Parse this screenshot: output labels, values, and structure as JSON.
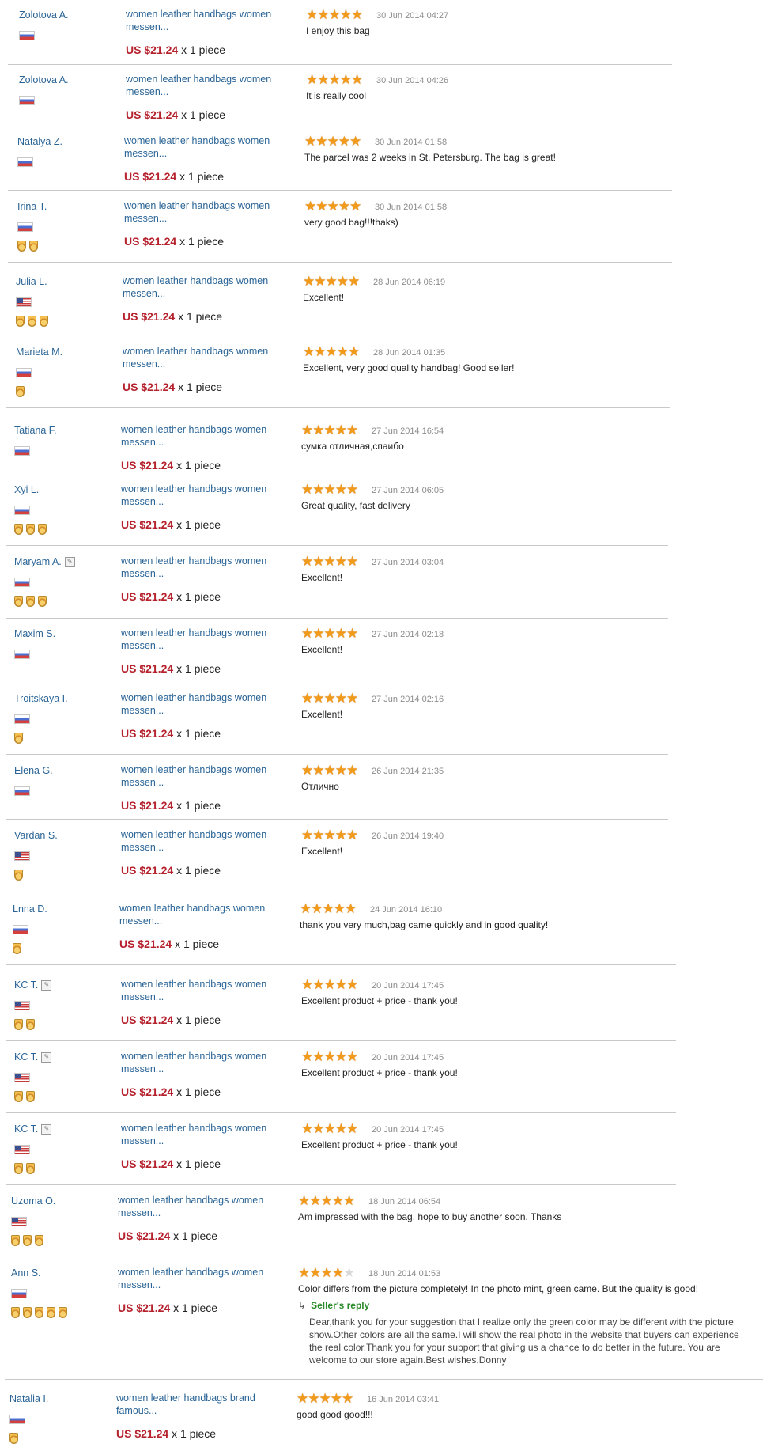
{
  "reviews": [
    {
      "name": "Zolotova A.",
      "flag": "ru",
      "medals": 0,
      "edit": false,
      "product": "women leather handbags women messen...",
      "price": "US $21.24",
      "qty": "x 1 piece",
      "rating": 5,
      "date": "30 Jun 2014 04:27",
      "text": "I enjoy this bag"
    },
    {
      "name": "Zolotova A.",
      "flag": "ru",
      "medals": 0,
      "edit": false,
      "product": "women leather handbags women messen...",
      "price": "US $21.24",
      "qty": "x 1 piece",
      "rating": 5,
      "date": "30 Jun 2014 04:26",
      "text": "It is really cool"
    },
    {
      "name": "Natalya Z.",
      "flag": "ru",
      "medals": 0,
      "edit": false,
      "product": "women leather handbags women messen...",
      "price": "US $21.24",
      "qty": "x 1 piece",
      "rating": 5,
      "date": "30 Jun 2014 01:58",
      "text": "The parcel was 2 weeks in St. Petersburg. The bag is great!"
    },
    {
      "name": "Irina T.",
      "flag": "ru",
      "medals": 2,
      "edit": false,
      "product": "women leather handbags women messen...",
      "price": "US $21.24",
      "qty": "x 1 piece",
      "rating": 5,
      "date": "30 Jun 2014 01:58",
      "text": "very good bag!!!thaks)"
    },
    {
      "name": "Julia L.",
      "flag": "us",
      "medals": 3,
      "edit": false,
      "product": "women leather handbags women messen...",
      "price": "US $21.24",
      "qty": "x 1 piece",
      "rating": 5,
      "date": "28 Jun 2014 06:19",
      "text": "Excellent!"
    },
    {
      "name": "Marieta M.",
      "flag": "ru",
      "medals": 1,
      "edit": false,
      "product": "women leather handbags women messen...",
      "price": "US $21.24",
      "qty": "x 1 piece",
      "rating": 5,
      "date": "28 Jun 2014 01:35",
      "text": "Excellent, very good quality handbag! Good seller!"
    },
    {
      "name": "Tatiana F.",
      "flag": "ru",
      "medals": 0,
      "edit": false,
      "product": "women leather handbags women messen...",
      "price": "US $21.24",
      "qty": "x 1 piece",
      "rating": 5,
      "date": "27 Jun 2014 16:54",
      "text": "сумка отличная,спаибо"
    },
    {
      "name": "Xyi L.",
      "flag": "ru",
      "medals": 3,
      "edit": false,
      "product": "women leather handbags women messen...",
      "price": "US $21.24",
      "qty": "x 1 piece",
      "rating": 5,
      "date": "27 Jun 2014 06:05",
      "text": "Great quality, fast delivery"
    },
    {
      "name": "Maryam A.",
      "flag": "ru",
      "medals": 3,
      "edit": true,
      "product": "women leather handbags women messen...",
      "price": "US $21.24",
      "qty": "x 1 piece",
      "rating": 5,
      "date": "27 Jun 2014 03:04",
      "text": "Excellent!"
    },
    {
      "name": "Maxim S.",
      "flag": "ru",
      "medals": 0,
      "edit": false,
      "product": "women leather handbags women messen...",
      "price": "US $21.24",
      "qty": "x 1 piece",
      "rating": 5,
      "date": "27 Jun 2014 02:18",
      "text": "Excellent!"
    },
    {
      "name": "Troitskaya I.",
      "flag": "ru",
      "medals": 1,
      "edit": false,
      "product": "women leather handbags women messen...",
      "price": "US $21.24",
      "qty": "x 1 piece",
      "rating": 5,
      "date": "27 Jun 2014 02:16",
      "text": "Excellent!"
    },
    {
      "name": "Elena G.",
      "flag": "ru",
      "medals": 0,
      "edit": false,
      "product": "women leather handbags women messen...",
      "price": "US $21.24",
      "qty": "x 1 piece",
      "rating": 5,
      "date": "26 Jun 2014 21:35",
      "text": "Отлично"
    },
    {
      "name": "Vardan S.",
      "flag": "us",
      "medals": 1,
      "edit": false,
      "product": "women leather handbags women messen...",
      "price": "US $21.24",
      "qty": "x 1 piece",
      "rating": 5,
      "date": "26 Jun 2014 19:40",
      "text": "Excellent!"
    },
    {
      "name": "Lnna D.",
      "flag": "ru",
      "medals": 1,
      "edit": false,
      "product": "women leather handbags women messen...",
      "price": "US $21.24",
      "qty": "x 1 piece",
      "rating": 5,
      "date": "24 Jun 2014 16:10",
      "text": "thank you very much,bag came quickly and in good quality!"
    },
    {
      "name": "KC T.",
      "flag": "us",
      "medals": 2,
      "edit": true,
      "product": "women leather handbags women messen...",
      "price": "US $21.24",
      "qty": "x 1 piece",
      "rating": 5,
      "date": "20 Jun 2014 17:45",
      "text": "Excellent product + price - thank you!"
    },
    {
      "name": "KC T.",
      "flag": "us",
      "medals": 2,
      "edit": true,
      "product": "women leather handbags women messen...",
      "price": "US $21.24",
      "qty": "x 1 piece",
      "rating": 5,
      "date": "20 Jun 2014 17:45",
      "text": "Excellent product + price - thank you!"
    },
    {
      "name": "KC T.",
      "flag": "us",
      "medals": 2,
      "edit": true,
      "product": "women leather handbags women messen...",
      "price": "US $21.24",
      "qty": "x 1 piece",
      "rating": 5,
      "date": "20 Jun 2014 17:45",
      "text": "Excellent product + price - thank you!"
    },
    {
      "name": "Uzoma O.",
      "flag": "us",
      "medals": 3,
      "edit": false,
      "product": "women leather handbags women messen...",
      "price": "US $21.24",
      "qty": "x 1 piece",
      "rating": 5,
      "date": "18 Jun 2014 06:54",
      "text": "Am impressed with the bag, hope to buy another soon. Thanks"
    },
    {
      "name": "Ann S.",
      "flag": "ru",
      "medals": 5,
      "edit": false,
      "product": "women leather handbags women messen...",
      "price": "US $21.24",
      "qty": "x 1 piece",
      "rating": 4,
      "date": "18 Jun 2014 01:53",
      "text": "Color differs from the picture completely! In the photo mint, green came. But the quality is good!",
      "reply_label": "Seller's reply",
      "reply": "Dear,thank you for your suggestion that I realize only the green color may be different with the picture show.Other colors are all the same.I will show the real photo in the website that buyers can experience the real color.Thank you for your support that giving us a chance to do better in the future. You are welcome to our store again.Best wishes.Donny"
    },
    {
      "name": "Natalia I.",
      "flag": "ru",
      "medals": 1,
      "edit": false,
      "product": "women leather handbags brand famous...",
      "price": "US $21.24",
      "qty": "x 1 piece",
      "rating": 5,
      "date": "16 Jun 2014 03:41",
      "text": "good good good!!!"
    }
  ],
  "colors": {
    "link": "#2a6496",
    "price": "#b5212c",
    "star": "#f29b1b",
    "reply": "#2a8a2a",
    "date": "#8c8c8c"
  }
}
